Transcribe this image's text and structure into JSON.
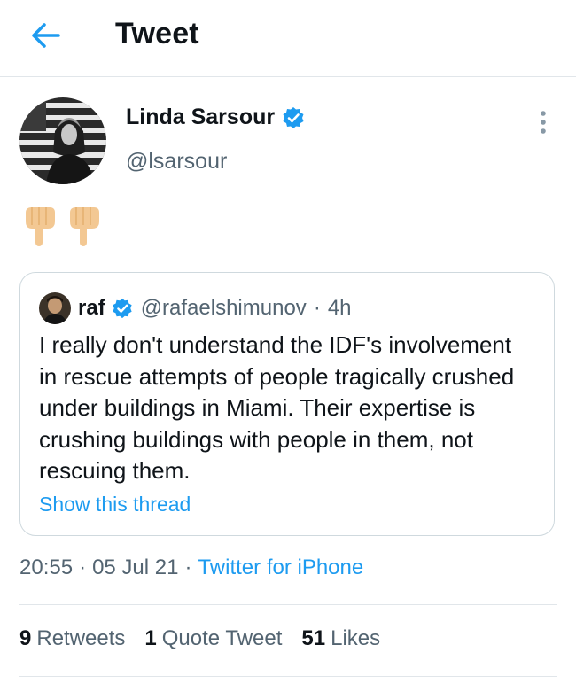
{
  "header": {
    "title": "Tweet",
    "back_icon": "back-arrow-icon"
  },
  "tweet": {
    "author": {
      "name": "Linda Sarsour",
      "handle": "@lsarsour",
      "verified": true
    },
    "body_emoji": [
      "👇",
      "👇"
    ],
    "quoted": {
      "name": "raf",
      "handle": "@rafaelshimunov",
      "separator": "·",
      "time": "4h",
      "text": "I really don't understand the IDF's involvement in rescue attempts of people tragically crushed under buildings in Miami. Their expertise is crushing buildings with people in them, not rescuing them.",
      "show_thread": "Show this thread"
    },
    "meta": {
      "time": "20:55",
      "date": "05 Jul 21",
      "separator": "·",
      "source": "Twitter for iPhone"
    },
    "stats": {
      "retweets_count": "9",
      "retweets_label": "Retweets",
      "quotes_count": "1",
      "quotes_label": "Quote Tweet",
      "likes_count": "51",
      "likes_label": "Likes"
    }
  },
  "colors": {
    "accent": "#1d9bf0",
    "secondary_text": "#536471",
    "primary_text": "#0f1419",
    "border": "#cfd9de"
  }
}
